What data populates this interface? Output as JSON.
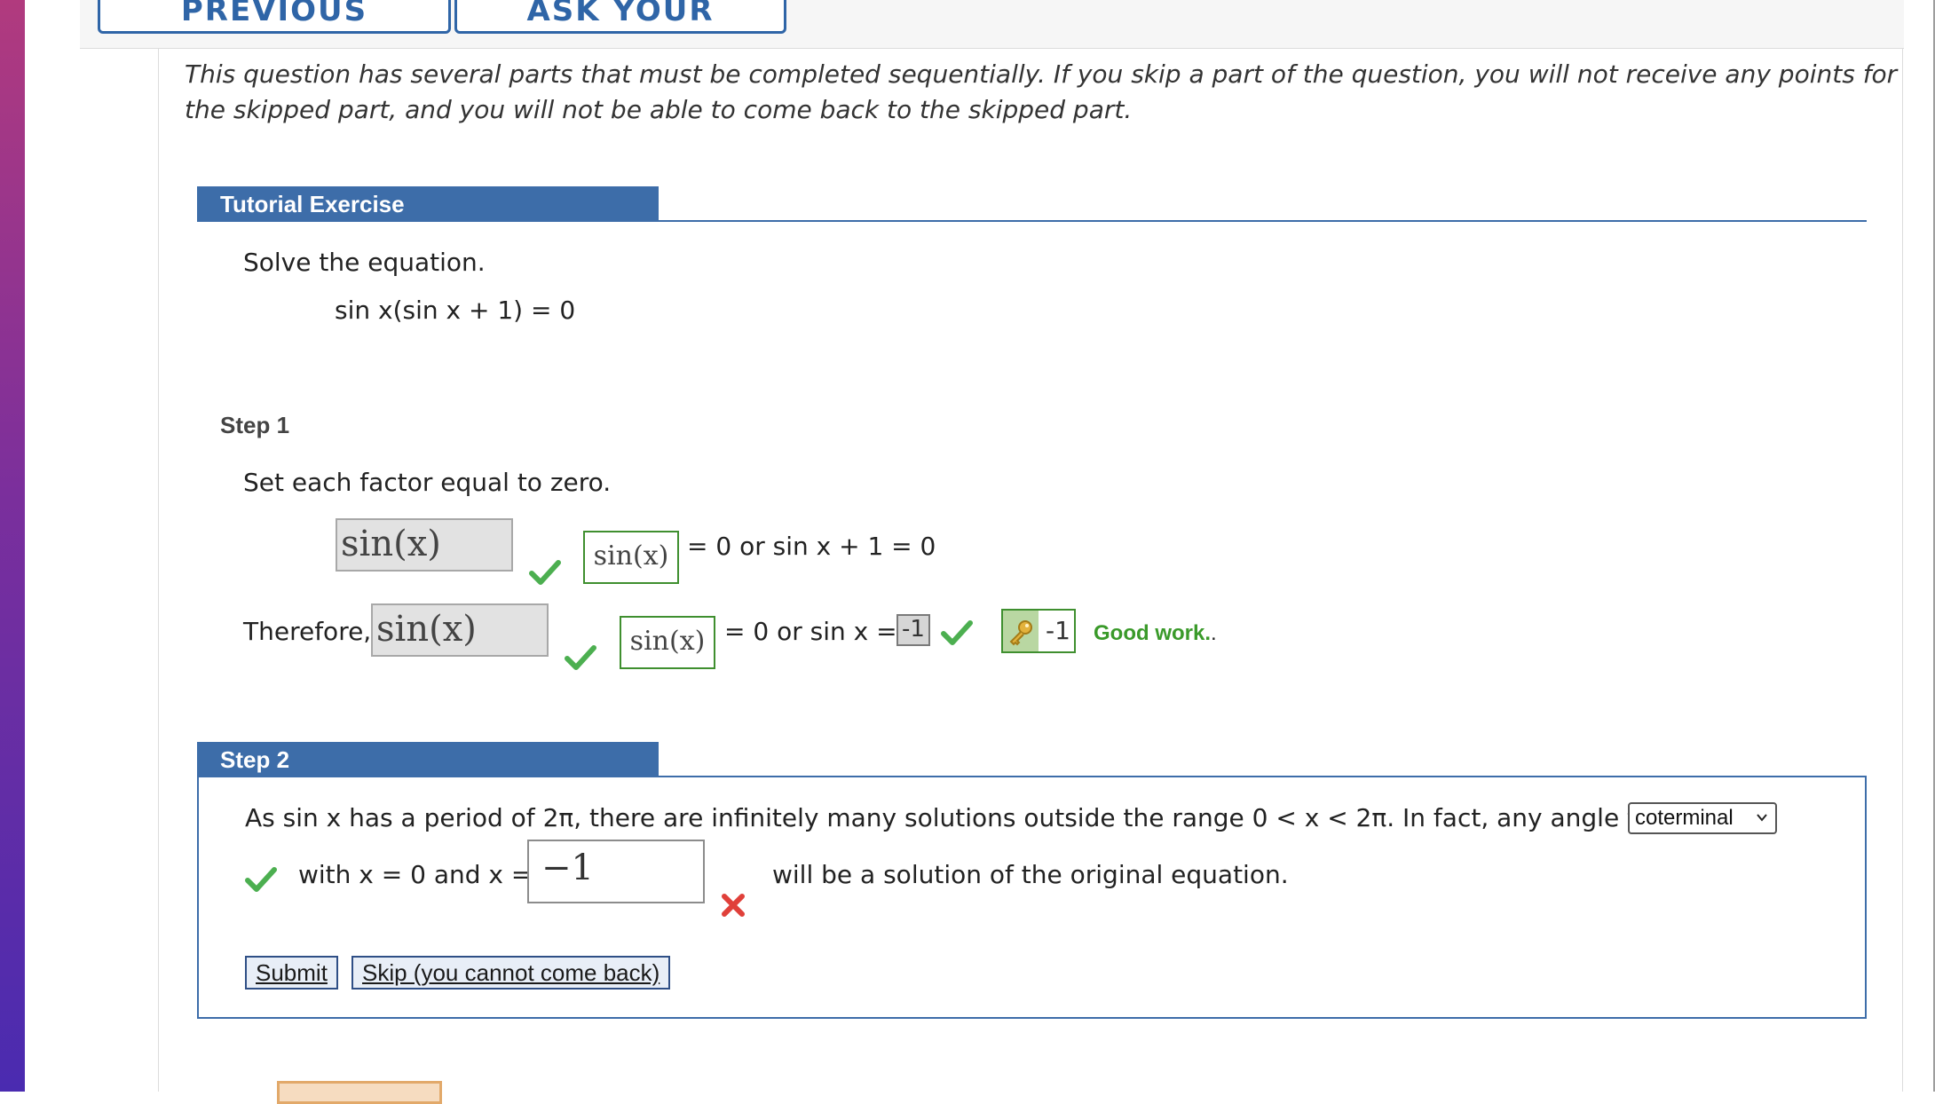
{
  "top_buttons": {
    "previous_answers": "PREVIOUS ANSWERS",
    "ask_teacher": "ASK YOUR TEACHER"
  },
  "intro": "This question has several parts that must be completed sequentially. If you skip a part of the question, you will not receive any points for the skipped part, and you will not be able to come back to the skipped part.",
  "tutorial": {
    "header": "Tutorial Exercise",
    "prompt": "Solve the equation.",
    "equation": "sin x(sin x + 1) = 0"
  },
  "step1": {
    "label": "Step 1",
    "instruction": "Set each factor equal to zero.",
    "row1": {
      "answer_gray": "sin(x)",
      "answer_box": "sin(x)",
      "tail": "= 0 or sin x + 1 = 0"
    },
    "row2": {
      "prefix": "Therefore,",
      "answer_gray": "sin(x)",
      "answer_box": "sin(x)",
      "mid": "= 0 or sin x =",
      "value": "-1",
      "key_value": "-1",
      "feedback": "Good work.",
      "feedback_suffix": "."
    }
  },
  "step2": {
    "label": "Step 2",
    "text_before": "As sin x has a period of 2π, there are infinitely many solutions outside the range 0 < x < 2π. In fact, any angle that is",
    "select_value": "coterminal",
    "with_text": "with x = 0 and x =",
    "input_value": "−1",
    "after_text": "will be a solution of the original equation.",
    "submit": "Submit",
    "skip": "Skip (you cannot come back)"
  },
  "colors": {
    "accent_blue": "#3d6da9",
    "success_green": "#3a9a2a",
    "error_red": "#e0403a"
  }
}
